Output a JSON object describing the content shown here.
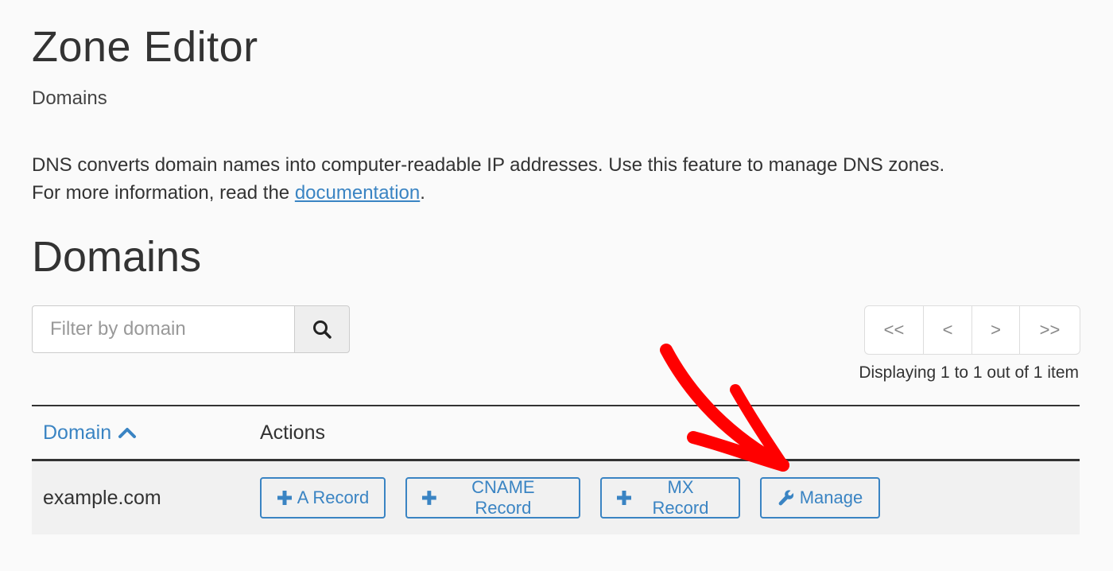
{
  "header": {
    "title": "Zone Editor",
    "subtitle": "Domains"
  },
  "description": {
    "line1": "DNS converts domain names into computer-readable IP addresses. Use this feature to manage DNS zones.",
    "line2_prefix": "For more information, read the ",
    "link_text": "documentation",
    "line2_suffix": "."
  },
  "section": {
    "title": "Domains"
  },
  "search": {
    "placeholder": "Filter by domain",
    "value": "",
    "icon": "search-icon"
  },
  "pagination": {
    "first_label": "<<",
    "prev_label": "<",
    "next_label": ">",
    "last_label": ">>",
    "info": "Displaying 1 to 1 out of 1 item"
  },
  "table": {
    "columns": [
      {
        "label": "Domain",
        "sort": "ascending",
        "icon": "chevron-up-icon"
      },
      {
        "label": "Actions"
      }
    ],
    "rows": [
      {
        "domain": "example.com",
        "actions": [
          {
            "label": "A Record",
            "icon": "plus-icon"
          },
          {
            "label": "CNAME Record",
            "icon": "plus-icon"
          },
          {
            "label": "MX Record",
            "icon": "plus-icon"
          },
          {
            "label": "Manage",
            "icon": "wrench-icon"
          }
        ]
      }
    ]
  },
  "annotation": {
    "type": "red-arrow",
    "points_to": "Manage",
    "color": "#ff0000"
  },
  "colors": {
    "accent": "#3a84c3",
    "text": "#333333",
    "background": "#fafafa",
    "row_background": "#f1f1f1"
  }
}
